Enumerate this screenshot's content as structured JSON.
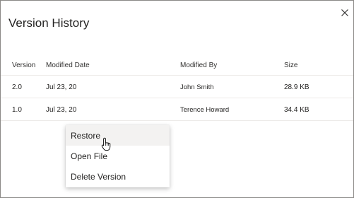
{
  "dialog": {
    "title": "Version History",
    "close_icon": "close-icon"
  },
  "table": {
    "columns": [
      "Version",
      "Modified Date",
      "Modified By",
      "Size"
    ],
    "rows": [
      {
        "version": "2.0",
        "modified_date": "Jul 23, 20",
        "modified_by": "John Smith",
        "size": "28.9 KB"
      },
      {
        "version": "1.0",
        "modified_date": "Jul 23, 20",
        "modified_by": "Terence Howard",
        "size": "34.4 KB"
      }
    ]
  },
  "context_menu": {
    "items": [
      "Restore",
      "Open File",
      "Delete Version"
    ],
    "hovered_item": "Restore"
  },
  "colors": {
    "border": "#8a8886",
    "divider": "#edebe9",
    "hover": "#f3f2f1",
    "text": "#252423"
  },
  "cursor_icon": "hand-pointer-icon"
}
